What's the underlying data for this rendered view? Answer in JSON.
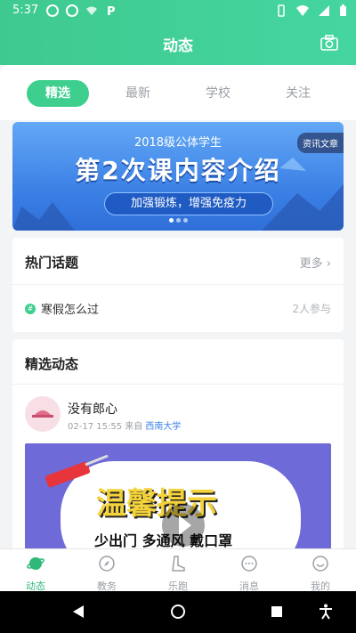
{
  "status_bar": {
    "time": "5:37"
  },
  "header": {
    "title": "动态"
  },
  "tabs": [
    {
      "label": "精选",
      "active": true
    },
    {
      "label": "最新",
      "active": false
    },
    {
      "label": "学校",
      "active": false
    },
    {
      "label": "关注",
      "active": false
    }
  ],
  "banner": {
    "badge": "资讯文章",
    "subtitle": "2018级公体学生",
    "headline": "第2次课内容介绍",
    "tagline": "加强锻炼，增强免疫力"
  },
  "hot_topics": {
    "title": "热门话题",
    "more_label": "更多",
    "items": [
      {
        "name": "寒假怎么过",
        "count": "2人参与"
      }
    ]
  },
  "featured": {
    "title": "精选动态",
    "post": {
      "user": "没有郎心",
      "time": "02-17 15:55 来自",
      "school": "西南大学",
      "image_text_1": "温馨提示",
      "image_text_2": "少出门 多通风 戴口罩"
    }
  },
  "bottom_nav": [
    {
      "label": "动态",
      "active": true
    },
    {
      "label": "教务",
      "active": false
    },
    {
      "label": "乐跑",
      "active": false
    },
    {
      "label": "消息",
      "active": false
    },
    {
      "label": "我的",
      "active": false
    }
  ],
  "colors": {
    "brand": "#3ecf8e",
    "link": "#3d82e6"
  }
}
